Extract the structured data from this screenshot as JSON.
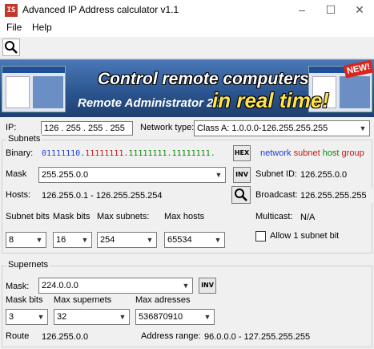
{
  "window": {
    "icon_text": "IS",
    "title": "Advanced IP Address calculator v1.1",
    "minimize": "–",
    "maximize": "☐",
    "close": "✕"
  },
  "menu": {
    "file": "File",
    "help": "Help"
  },
  "toolbar": {
    "search_icon": "magnifier-icon"
  },
  "banner": {
    "headline": "Control remote computers",
    "product": "Remote Administrator 2.1",
    "tagline": "in real time!",
    "badge": "NEW!"
  },
  "ip": {
    "label": "IP:",
    "value": "126 . 255 . 255 . 255",
    "network_type_label": "Network type:",
    "network_type_value": "Class A:   1.0.0.0-126.255.255.255"
  },
  "subnets": {
    "title": "Subnets",
    "binary_label": "Binary:",
    "binary_net": "01111110.",
    "binary_subnet": "11111111.",
    "binary_host": "11111111.11111111.",
    "hex_button": "HEX",
    "legend_network": "network",
    "legend_subnet": "subnet",
    "legend_host": "host",
    "legend_group": "group",
    "mask_label": "Mask",
    "mask_value": "255.255.0.0",
    "inv_button": "INV",
    "subnet_id_label": "Subnet ID:",
    "subnet_id_value": "126.255.0.0",
    "hosts_label": "Hosts:",
    "hosts_value": "126.255.0.1 - 126.255.255.254",
    "broadcast_label": "Broadcast:",
    "broadcast_value": "126.255.255.255",
    "subnet_bits_label": "Subnet bits",
    "mask_bits_label": "Mask bits",
    "max_subnets_label": "Max subnets:",
    "max_hosts_label": "Max hosts",
    "multicast_label": "Multicast:",
    "multicast_value": "N/A",
    "subnet_bits_value": "8",
    "mask_bits_value": "16",
    "max_subnets_value": "254",
    "max_hosts_value": "65534",
    "allow_subnet_label": "Allow 1 subnet bit"
  },
  "supernets": {
    "title": "Supernets",
    "mask_label": "Mask:",
    "mask_value": "224.0.0.0",
    "inv_button": "INV",
    "mask_bits_label": "Mask bits",
    "max_supernets_label": "Max supernets",
    "max_addresses_label": "Max adresses",
    "mask_bits_value": "3",
    "max_supernets_value": "32",
    "max_addresses_value": "536870910",
    "route_label": "Route",
    "route_value": "126.255.0.0",
    "address_range_label": "Address range:",
    "address_range_value": "96.0.0.0 - 127.255.255.255"
  },
  "colors": {
    "network": "#1a3fd6",
    "subnet": "#c01818",
    "host": "#0a8a0a"
  }
}
